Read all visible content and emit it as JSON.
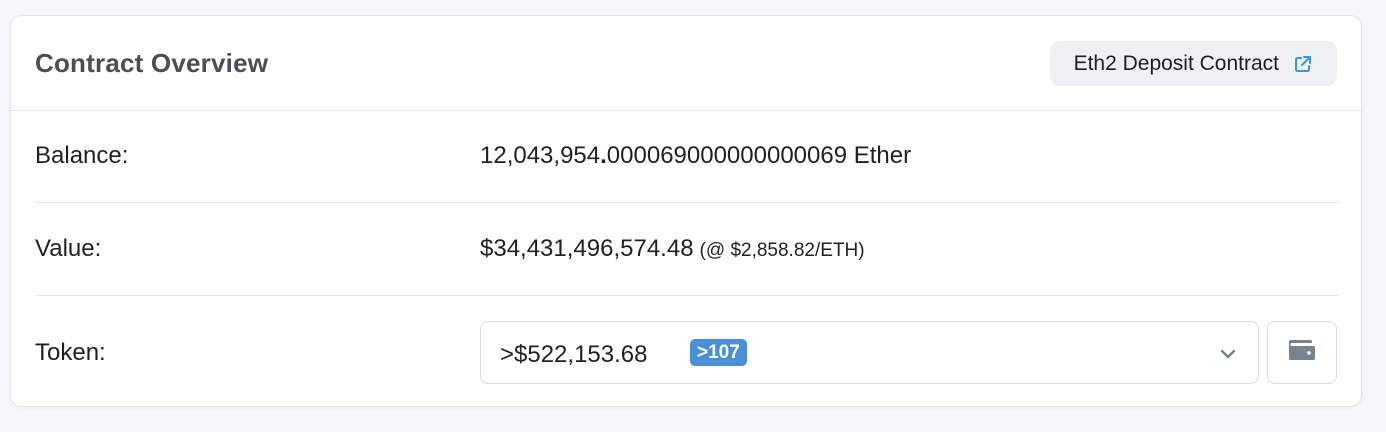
{
  "header": {
    "title": "Contract Overview",
    "tag_label": "Eth2 Deposit Contract",
    "tag_icon": "external-link-icon"
  },
  "rows": {
    "balance": {
      "label": "Balance:",
      "value_int": "12,043,954",
      "value_dot": ".",
      "value_frac": "000069000000000069 Ether"
    },
    "value": {
      "label": "Value:",
      "value": "$34,431,496,574.48",
      "rate": "(@ $2,858.82/ETH)"
    },
    "token": {
      "label": "Token:",
      "value": ">$522,153.68",
      "badge": ">107",
      "dropdown_icon": "chevron-down-icon",
      "wallet_icon": "wallet-icon"
    }
  },
  "colors": {
    "badge": "#4a90d9",
    "link_icon": "#3498db",
    "title": "#4a4f55"
  }
}
